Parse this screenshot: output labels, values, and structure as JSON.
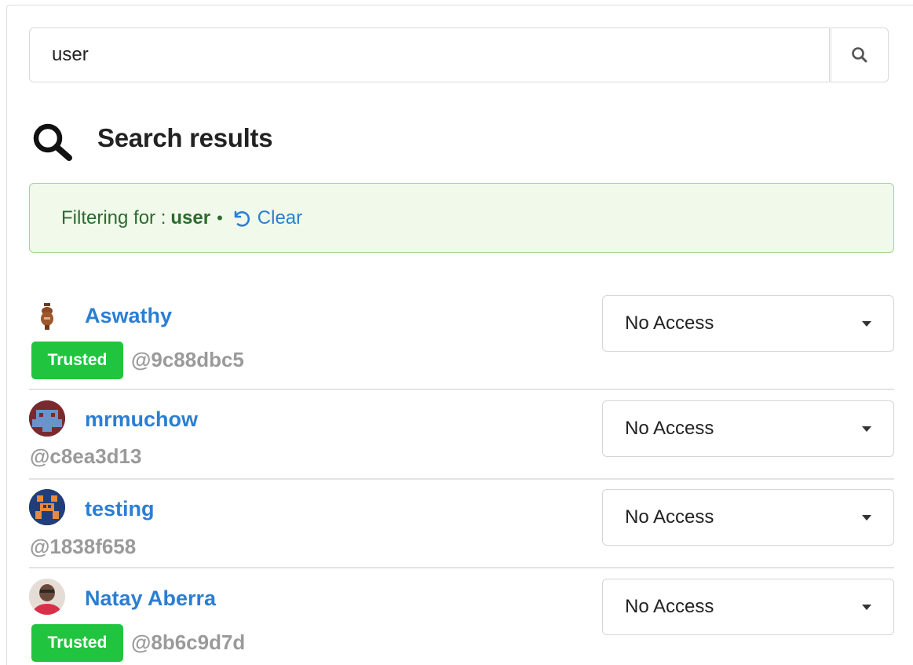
{
  "search": {
    "value": "user"
  },
  "heading": {
    "title": "Search results",
    "icon": "search-icon"
  },
  "filter": {
    "prefix": "Filtering for :",
    "term": "user",
    "separator": "•",
    "clear_label": "Clear",
    "clear_icon": "undo-icon"
  },
  "colors": {
    "link": "#2b7ed1",
    "trusted_badge": "#21c43f",
    "filter_bg": "#f0f9ea",
    "filter_border": "#a7d58a",
    "filter_text": "#2d6a2e",
    "handle": "#9a9a9a"
  },
  "results": [
    {
      "name": "Aswathy",
      "handle": "@9c88dbc5",
      "trusted": true,
      "badge": "Trusted",
      "access": "No Access",
      "avatar": "vase-avatar"
    },
    {
      "name": "mrmuchow",
      "handle": "@c8ea3d13",
      "trusted": false,
      "access": "No Access",
      "avatar": "pixel-avatar-red-blue"
    },
    {
      "name": "testing",
      "handle": "@1838f658",
      "trusted": false,
      "access": "No Access",
      "avatar": "pixel-avatar-navy-orange"
    },
    {
      "name": "Natay Aberra",
      "handle": "@8b6c9d7d",
      "trusted": true,
      "badge": "Trusted",
      "access": "No Access",
      "avatar": "photo-avatar"
    }
  ]
}
